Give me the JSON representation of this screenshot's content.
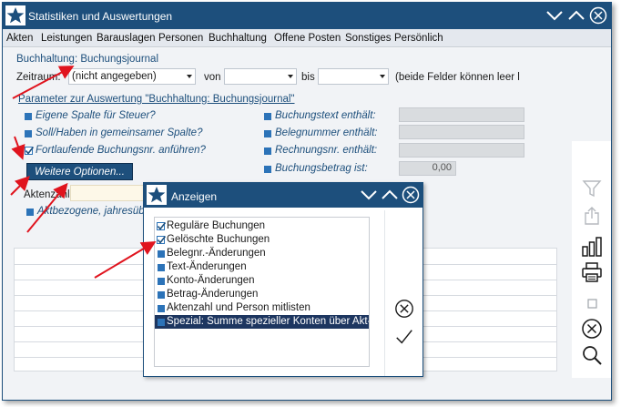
{
  "window": {
    "title": "Statistiken und Auswertungen"
  },
  "menu": [
    "Akten",
    "Leistungen",
    "Barauslagen",
    "Personen",
    "Buchhaltung",
    "Offene Posten",
    "Sonstiges",
    "Persönlich"
  ],
  "report": {
    "heading": "Buchhaltung: Buchungsjournal",
    "zeitraum_label": "Zeitraum:",
    "zeitraum_value": "(nicht angegeben)",
    "von_label": "von",
    "bis_label": "bis",
    "hint": "(beide Felder können leer l",
    "params_heading": "Parameter zur Auswertung \"Buchhaltung: Buchungsjournal\"",
    "options_left": [
      {
        "label": "Eigene Spalte für Steuer?",
        "checked": false
      },
      {
        "label": "Soll/Haben in gemeinsamer Spalte?",
        "checked": false
      },
      {
        "label": "Fortlaufende Buchungsnr. anführen?",
        "checked": true
      }
    ],
    "options_right": [
      {
        "label": "Buchungstext enthält:",
        "value": ""
      },
      {
        "label": "Belegnummer enthält:",
        "value": ""
      },
      {
        "label": "Rechnungsnr. enthält:",
        "value": ""
      },
      {
        "label": "Buchungsbetrag ist:",
        "value": "0,00"
      }
    ],
    "more_options_button": "Weitere Optionen...",
    "aktenzahl_label": "Aktenzahl",
    "aktbezogen_label": "Aktbezogene, jahresübe"
  },
  "dialog": {
    "title": "Anzeigen",
    "items": [
      {
        "label": "Reguläre Buchungen",
        "checked": true
      },
      {
        "label": "Gelöschte Buchungen",
        "checked": true
      },
      {
        "label": "Belegnr.-Änderungen",
        "checked": false
      },
      {
        "label": "Text-Änderungen",
        "checked": false
      },
      {
        "label": "Konto-Änderungen",
        "checked": false
      },
      {
        "label": "Betrag-Änderungen",
        "checked": false
      },
      {
        "label": "Aktenzahl und Person mitlisten",
        "checked": false
      },
      {
        "label": "Spezial: Summe spezieller Konten über Akt-R",
        "checked": false,
        "selected": true
      }
    ],
    "cancel_icon": "circle-x-icon",
    "ok_icon": "checkmark-icon"
  },
  "sidebar_icons": [
    "filter-icon",
    "export-icon",
    "chart-icon",
    "printer-icon",
    "square-icon",
    "circle-x-icon",
    "search-icon"
  ],
  "colors": {
    "titlebar": "#1d4f7c",
    "accent": "#2c73b8",
    "selection": "#1d3660",
    "annotation_arrow": "#e0141e"
  }
}
